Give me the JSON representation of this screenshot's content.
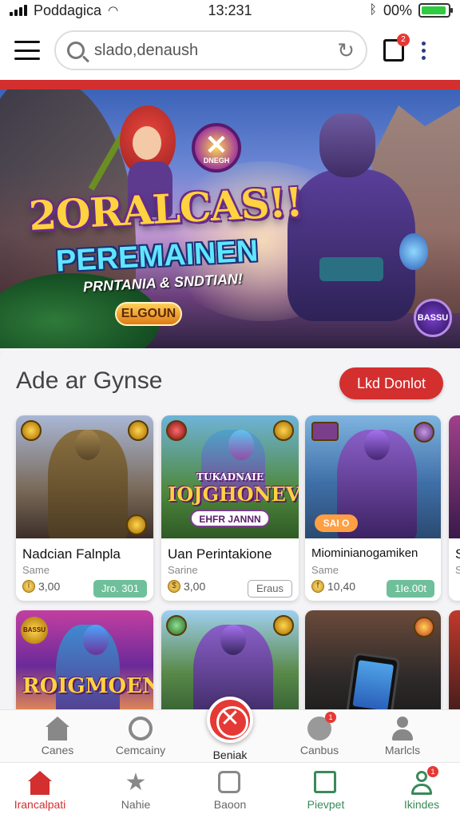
{
  "status": {
    "carrier": "Poddagica",
    "time": "13:231",
    "battery_text": "00%",
    "battery_level": 0.95
  },
  "header": {
    "search_value": "slado,denaush",
    "notification_count": "2"
  },
  "hero": {
    "badge_label": "DNEGH",
    "title": "2ORALCAS!!",
    "subtitle": "PEREMAINEN",
    "tagline": "PRNTANIA & SNDTIAN!",
    "login_label": "ELGOUN",
    "corner_badge": "BASSU"
  },
  "section": {
    "title": "Ade ar Gynse",
    "action_label": "Lkd Donlot"
  },
  "cards": [
    {
      "name": "Nadcian Falnpla",
      "sub": "Same",
      "price": "3,00",
      "tag": "Jro. 301"
    },
    {
      "name": "Uan Perintakione",
      "sub": "Sarine",
      "price": "3,00",
      "tag": "Eraus",
      "art_title": "IOJGHONEV",
      "art_top": "TUKADNAIE",
      "art_pill": "EHFR JANNN"
    },
    {
      "name": "Miominianogamiken",
      "sub": "Same",
      "price": "10,40",
      "tag": "1Ie.00t",
      "art_pill": "SAI O"
    },
    {
      "art_title": "ROIGMOEN",
      "corner": "BASSU"
    },
    {},
    {}
  ],
  "partial_card": {
    "name": "S",
    "sub": "S"
  },
  "tabbar_top": [
    {
      "label": "Canes",
      "icon": "home-icon"
    },
    {
      "label": "Cemcainy",
      "icon": "globe-icon"
    },
    {
      "label": "Beniak",
      "icon": "close-circle-icon"
    },
    {
      "label": "Canbus",
      "icon": "bell-icon",
      "badge": "1"
    },
    {
      "label": "Marlcls",
      "icon": "user-icon"
    }
  ],
  "tabbar_bottom": [
    {
      "label": "Irancalpati",
      "icon": "home-icon",
      "active": true
    },
    {
      "label": "Nahie",
      "icon": "star-icon"
    },
    {
      "label": "Baoon",
      "icon": "face-icon"
    },
    {
      "label": "Pievpet",
      "icon": "chart-icon"
    },
    {
      "label": "Ikindes",
      "icon": "user-icon",
      "badge": "1"
    }
  ],
  "colors": {
    "accent": "#d32f2f",
    "tag_green": "#6fbf9a"
  }
}
